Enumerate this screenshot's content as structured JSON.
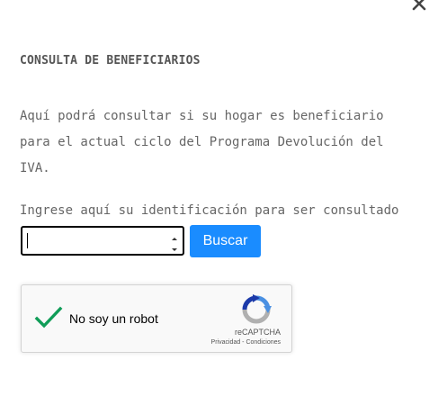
{
  "modal": {
    "close_icon": "close-icon",
    "title": "CONSULTA DE BENEFICIARIOS",
    "description_lines": [
      "Aquí podrá consultar si su hogar es beneficiario",
      "para el actual ciclo del Programa Devolución del",
      "IVA."
    ],
    "id_label": "Ingrese aquí su identificación para ser consultado",
    "id_input": {
      "value": "",
      "placeholder": ""
    },
    "search_button": "Buscar"
  },
  "recaptcha": {
    "label": "No soy un robot",
    "checked": true,
    "brand": "reCAPTCHA",
    "privacy": "Privacidad",
    "separator": " - ",
    "terms": "Condiciones"
  },
  "colors": {
    "accent": "#1a8cff",
    "check": "#109d58",
    "text": "#666666"
  }
}
